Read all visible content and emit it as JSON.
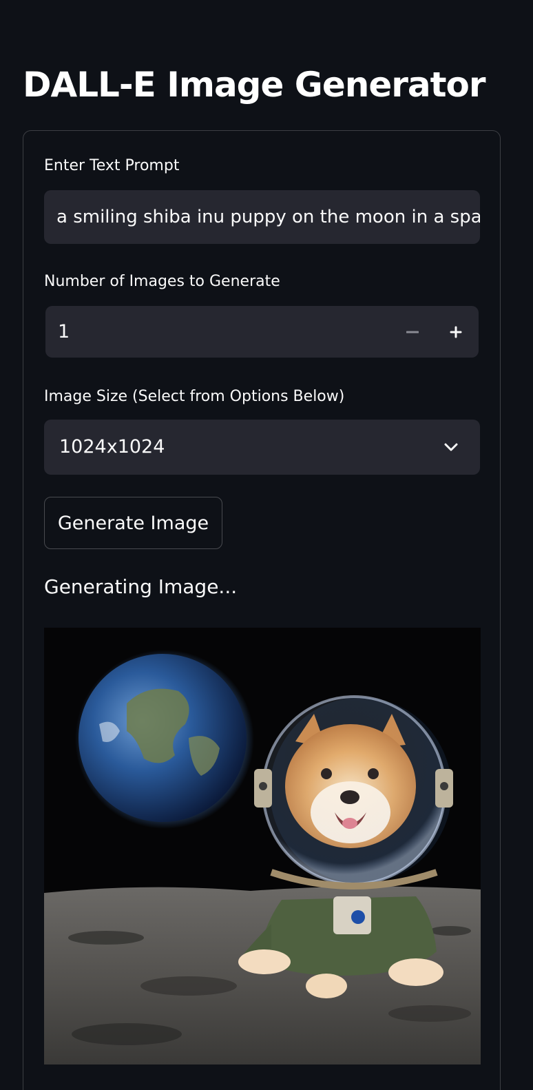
{
  "app": {
    "title": "DALL-E Image Generator"
  },
  "form": {
    "prompt": {
      "label": "Enter Text Prompt",
      "value": "a smiling shiba inu puppy on the moon in a spacesuit"
    },
    "num_images": {
      "label": "Number of Images to Generate",
      "value": "1",
      "decrement_symbol": "−",
      "increment_symbol": "+"
    },
    "size": {
      "label": "Image Size (Select from Options Below)",
      "selected": "1024x1024"
    },
    "generate_button": {
      "label": "Generate Image"
    },
    "status": {
      "text": "Generating Image..."
    },
    "result": {
      "description_icon": "generated-image"
    }
  },
  "colors": {
    "background": "#0e1117",
    "input_bg": "#262730",
    "text": "#fafafa"
  }
}
